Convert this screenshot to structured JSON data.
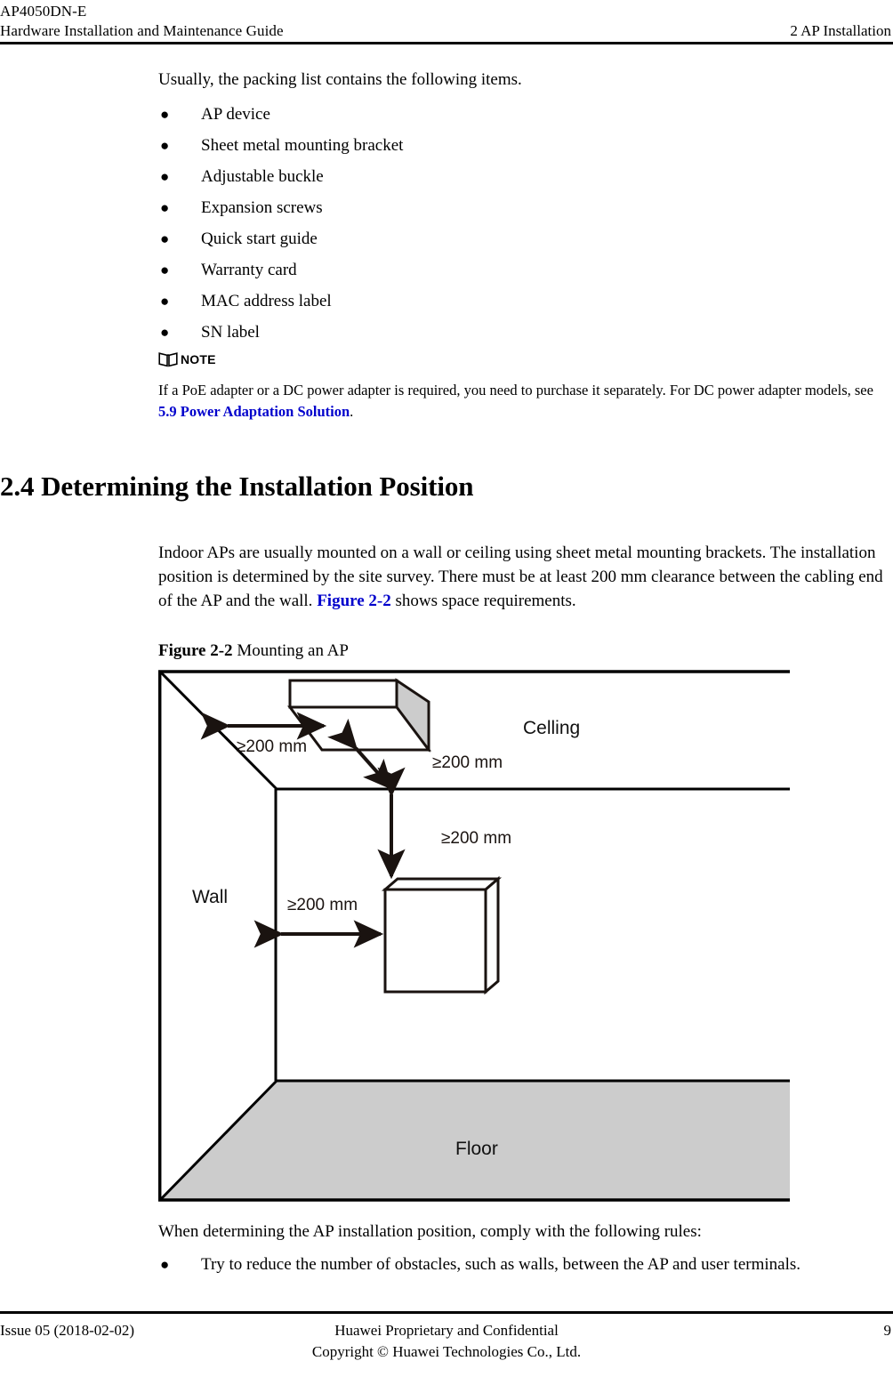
{
  "header": {
    "product": "AP4050DN-E",
    "doc_title": "Hardware Installation and Maintenance Guide",
    "chapter": "2 AP Installation"
  },
  "body": {
    "intro": "Usually, the packing list contains the following items.",
    "packing_list": [
      "AP device",
      "Sheet metal mounting bracket",
      "Adjustable buckle",
      "Expansion screws",
      "Quick start guide",
      "Warranty card",
      "MAC address label",
      "SN label"
    ],
    "bullet_glyph": "●"
  },
  "note": {
    "icon": "book-icon",
    "label": "NOTE",
    "text_before": "If a PoE adapter or a DC power adapter is required, you need to purchase it separately. For DC power adapter models, see ",
    "link_text": "5.9 Power Adaptation Solution",
    "text_after": ".",
    "link_color": "#0000CC"
  },
  "section": {
    "heading": "2.4 Determining the Installation Position",
    "paragraph_part1": "Indoor APs are usually mounted on a wall or ceiling using sheet metal mounting brackets. The installation position is determined by the site survey. There must be at least 200 mm clearance between the cabling end of the AP and the wall. ",
    "paragraph_link": "Figure 2-2",
    "paragraph_part2": " shows space requirements."
  },
  "figure": {
    "caption_number": "Figure 2-2",
    "caption_title": " Mounting an AP",
    "labels": {
      "ceiling": "Celling",
      "wall": "Wall",
      "floor": "Floor"
    },
    "dimensions": {
      "ceiling_to_wall": "≥200 mm",
      "ceiling_ap_to_wall_diag": "≥200 mm",
      "ceiling_to_wall_ap": "≥200 mm",
      "wall_ap_to_wall": "≥200 mm"
    },
    "colors": {
      "floor_fill": "#cccccc",
      "ap_side_fill": "#cccccc",
      "outline": "#1a1310"
    }
  },
  "rules": {
    "intro": "When determining the AP installation position, comply with the following rules:",
    "items": [
      "Try to reduce the number of obstacles, such as walls, between the AP and user terminals."
    ]
  },
  "footer": {
    "issue": "Issue 05 (2018-02-02)",
    "center_line1": "Huawei Proprietary and Confidential",
    "center_line2": "Copyright © Huawei Technologies Co., Ltd.",
    "page_number": "9"
  }
}
